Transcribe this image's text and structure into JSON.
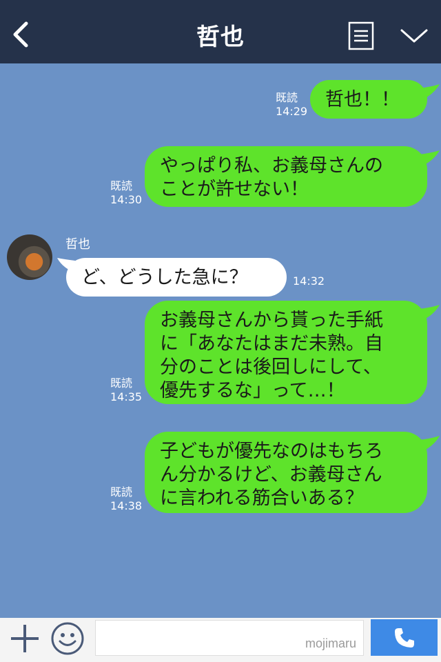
{
  "header": {
    "title": "哲也",
    "icons": [
      "back-chevron-icon",
      "menu-list-icon",
      "chevron-down-icon"
    ]
  },
  "messages": [
    {
      "id": "m1",
      "direction": "out",
      "read_label": "既読",
      "time": "14:29",
      "lines": [
        "哲也！！"
      ]
    },
    {
      "id": "m2",
      "direction": "out",
      "read_label": "既読",
      "time": "14:30",
      "lines": [
        "やっぱり私、お義母さんの",
        "ことが許せない！"
      ]
    },
    {
      "id": "m3",
      "direction": "in",
      "sender": "哲也",
      "time": "14:32",
      "lines": [
        "ど、どうした急に？"
      ]
    },
    {
      "id": "m4",
      "direction": "out",
      "read_label": "既読",
      "time": "14:35",
      "lines": [
        "お義母さんから貰った手紙",
        "に「あなたはまだ未熟。自",
        "分のことは後回しにして、",
        "優先するな」って…！"
      ]
    },
    {
      "id": "m5",
      "direction": "out",
      "read_label": "既読",
      "time": "14:38",
      "lines": [
        "子どもが優先なのはもちろ",
        "ん分かるけど、お義母さん",
        "に言われる筋合いある？"
      ]
    }
  ],
  "footer": {
    "input_value": "",
    "watermark": "mojimaru",
    "icons": [
      "plus-icon",
      "emoji-icon",
      "phone-icon"
    ]
  },
  "colors": {
    "header_bg": "#25324a",
    "chat_bg": "#6b92c6",
    "outgoing_bubble": "#5ee32b",
    "incoming_bubble": "#ffffff",
    "call_button": "#3e8ae6"
  }
}
